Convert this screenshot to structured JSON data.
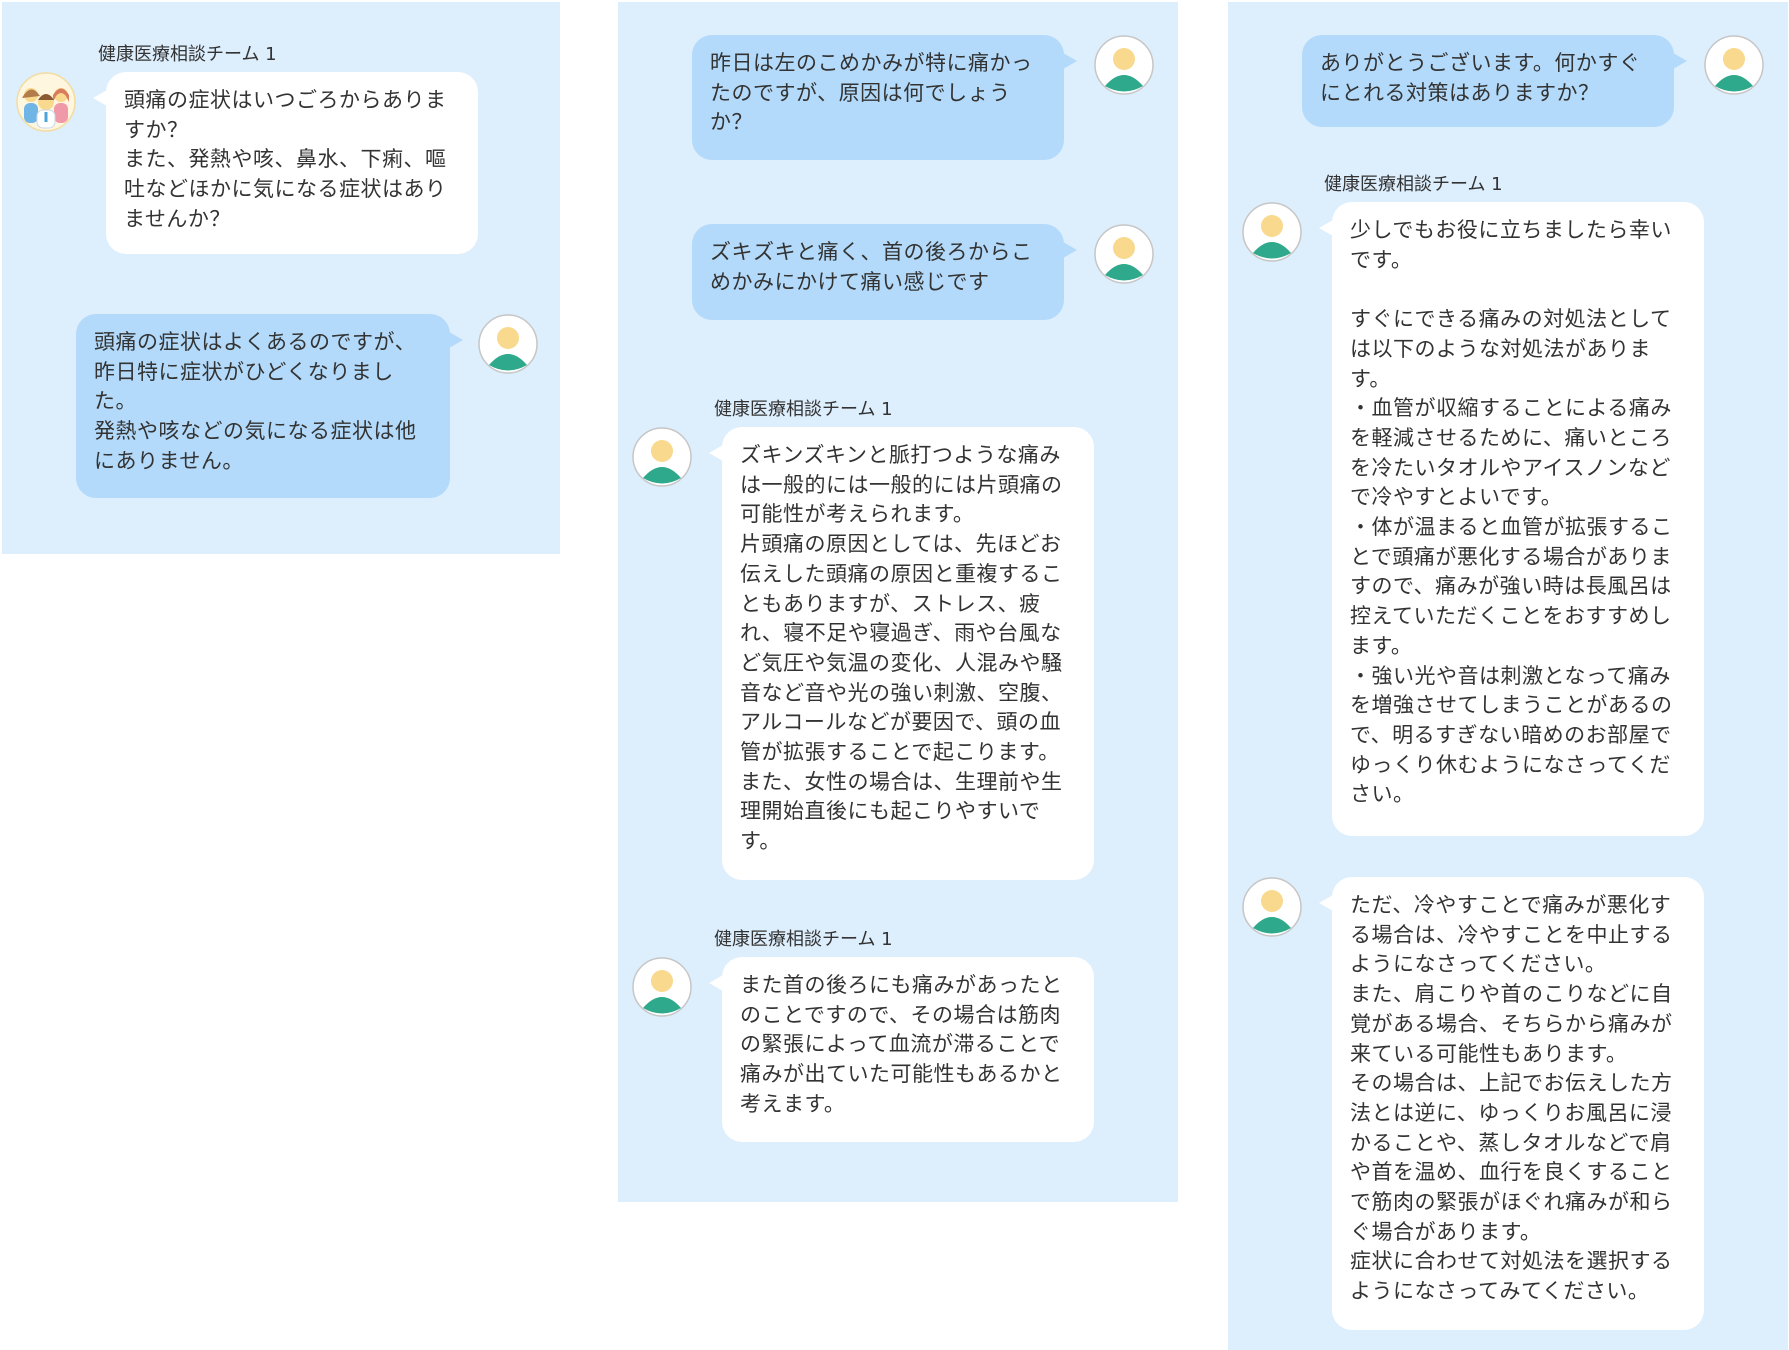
{
  "colors": {
    "panel_background": "#ddeefd",
    "agent_bubble": "#ffffff",
    "user_bubble": "#b3dafa",
    "avatar_skin": "#f8d98e",
    "avatar_body": "#2ea98b"
  },
  "panels": [
    {
      "messages": [
        {
          "role": "agent",
          "sender": "健康医療相談チーム 1",
          "avatar_icon": "medical-team-icon",
          "text": "頭痛の症状はいつごろからありま\nすか？\nまた、発熱や咳、鼻水、下痢、嘔\n吐などほかに気になる症状はあり\nませんか？"
        },
        {
          "role": "user",
          "avatar_icon": "user-avatar-icon",
          "text": "頭痛の症状はよくあるのですが、\n昨日特に症状がひどくなりまし\nた。\n発熱や咳などの気になる症状は他\nにありません。"
        }
      ]
    },
    {
      "messages": [
        {
          "role": "user",
          "avatar_icon": "user-avatar-icon",
          "text": "昨日は左のこめかみが特に痛かっ\nたのですが、原因は何でしょう\nか？"
        },
        {
          "role": "user",
          "avatar_icon": "user-avatar-icon",
          "text": "ズキズキと痛く、首の後ろからこ\nめかみにかけて痛い感じです"
        },
        {
          "role": "agent",
          "sender": "健康医療相談チーム 1",
          "avatar_icon": "agent-avatar-icon",
          "text": "ズキンズキンと脈打つような痛み\nは一般的には一般的には片頭痛の\n可能性が考えられます。\n片頭痛の原因としては、先ほどお\n伝えした頭痛の原因と重複するこ\nともありますが、ストレス、疲\nれ、寝不足や寝過ぎ、雨や台風な\nど気圧や気温の変化、人混みや騒\n音など音や光の強い刺激、空腹、\nアルコールなどが要因で、頭の血\n管が拡張することで起こります。\nまた、女性の場合は、生理前や生\n理開始直後にも起こりやすいで\nす。"
        },
        {
          "role": "agent",
          "sender": "健康医療相談チーム 1",
          "avatar_icon": "agent-avatar-icon",
          "text": "また首の後ろにも痛みがあったと\nのことですので、その場合は筋肉\nの緊張によって血流が滞ることで\n痛みが出ていた可能性もあるかと\n考えます。"
        }
      ]
    },
    {
      "messages": [
        {
          "role": "user",
          "avatar_icon": "user-avatar-icon",
          "text": "ありがとうございます。何かすぐ\nにとれる対策はありますか？"
        },
        {
          "role": "agent",
          "sender": "健康医療相談チーム 1",
          "avatar_icon": "agent-avatar-icon",
          "text": "少しでもお役に立ちましたら幸い\nです。\n\nすぐにできる痛みの対処法として\nは以下のような対処法がありま\nす。\n・血管が収縮することによる痛み\nを軽減させるために、痛いところ\nを冷たいタオルやアイスノンなど\nで冷やすとよいです。\n・体が温まると血管が拡張するこ\nとで頭痛が悪化する場合がありま\nすので、痛みが強い時は長風呂は\n控えていただくことをおすすめし\nます。\n・強い光や音は刺激となって痛み\nを増強させてしまうことがあるの\nで、明るすぎない暗めのお部屋で\nゆっくり休むようになさってくだ\nさい。"
        },
        {
          "role": "agent",
          "avatar_icon": "agent-avatar-icon",
          "text": "ただ、冷やすことで痛みが悪化す\nる場合は、冷やすことを中止する\nようになさってください。\nまた、肩こりや首のこりなどに自\n覚がある場合、そちらから痛みが\n来ている可能性もあります。\nその場合は、上記でお伝えした方\n法とは逆に、ゆっくりお風呂に浸\nかることや、蒸しタオルなどで肩\nや首を温め、血行を良くすること\nで筋肉の緊張がほぐれ痛みが和ら\nぐ場合があります。\n症状に合わせて対処法を選択する\nようになさってみてください。"
        }
      ]
    }
  ]
}
